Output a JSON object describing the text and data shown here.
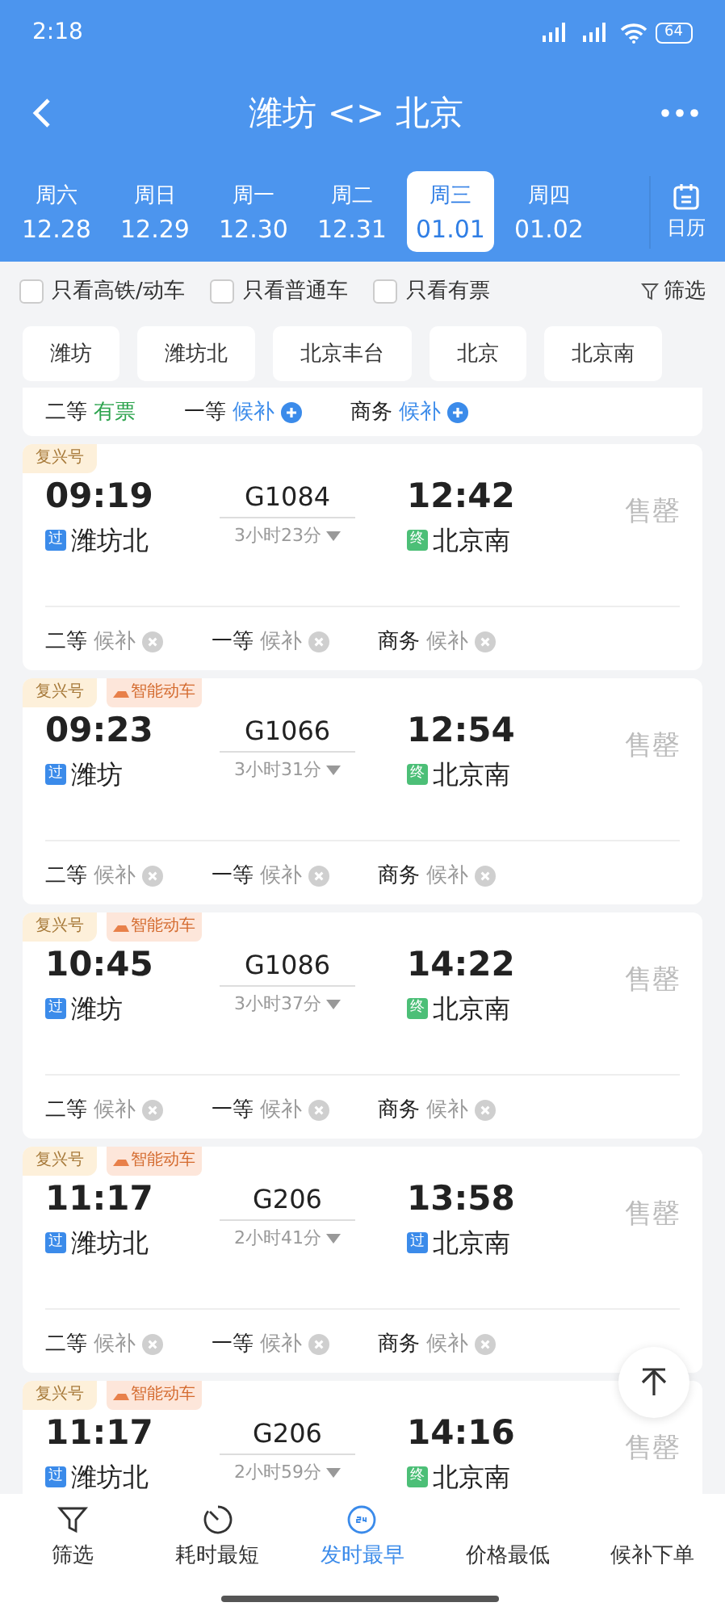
{
  "status_bar": {
    "time": "2:18",
    "battery": "64"
  },
  "header": {
    "title": "潍坊 <> 北京"
  },
  "dates": [
    {
      "weekday": "周六",
      "date": "12.28",
      "selected": false
    },
    {
      "weekday": "周日",
      "date": "12.29",
      "selected": false
    },
    {
      "weekday": "周一",
      "date": "12.30",
      "selected": false
    },
    {
      "weekday": "周二",
      "date": "12.31",
      "selected": false
    },
    {
      "weekday": "周三",
      "date": "01.01",
      "selected": true
    },
    {
      "weekday": "周四",
      "date": "01.02",
      "selected": false
    }
  ],
  "calendar_button": "日历",
  "filters": [
    {
      "label": "只看高铁/动车",
      "checked": false
    },
    {
      "label": "只看普通车",
      "checked": false
    },
    {
      "label": "只看有票",
      "checked": false
    }
  ],
  "filter_button": "筛选",
  "stations": [
    "潍坊",
    "潍坊北",
    "北京丰台",
    "北京",
    "北京南"
  ],
  "partial_card": {
    "seats": [
      {
        "class": "二等",
        "status": "有票",
        "kind": "available"
      },
      {
        "class": "一等",
        "status": "候补",
        "kind": "waitlist_open"
      },
      {
        "class": "商务",
        "status": "候补",
        "kind": "waitlist_open"
      }
    ]
  },
  "trains": [
    {
      "tags": [
        {
          "label": "复兴号",
          "kind": "plain"
        }
      ],
      "depart": "09:19",
      "number": "G1084",
      "arrive": "12:42",
      "duration": "3小时23分",
      "from": {
        "badge": "过",
        "name": "潍坊北",
        "kind": "pass"
      },
      "to": {
        "badge": "终",
        "name": "北京南",
        "kind": "terminal"
      },
      "status": "售罄",
      "seats": [
        {
          "class": "二等",
          "status": "候补",
          "kind": "waitlist_closed"
        },
        {
          "class": "一等",
          "status": "候补",
          "kind": "waitlist_closed"
        },
        {
          "class": "商务",
          "status": "候补",
          "kind": "waitlist_closed"
        }
      ]
    },
    {
      "tags": [
        {
          "label": "复兴号",
          "kind": "plain"
        },
        {
          "label": "智能动车",
          "kind": "smart"
        }
      ],
      "depart": "09:23",
      "number": "G1066",
      "arrive": "12:54",
      "duration": "3小时31分",
      "from": {
        "badge": "过",
        "name": "潍坊",
        "kind": "pass"
      },
      "to": {
        "badge": "终",
        "name": "北京南",
        "kind": "terminal"
      },
      "status": "售罄",
      "seats": [
        {
          "class": "二等",
          "status": "候补",
          "kind": "waitlist_closed"
        },
        {
          "class": "一等",
          "status": "候补",
          "kind": "waitlist_closed"
        },
        {
          "class": "商务",
          "status": "候补",
          "kind": "waitlist_closed"
        }
      ]
    },
    {
      "tags": [
        {
          "label": "复兴号",
          "kind": "plain"
        },
        {
          "label": "智能动车",
          "kind": "smart"
        }
      ],
      "depart": "10:45",
      "number": "G1086",
      "arrive": "14:22",
      "duration": "3小时37分",
      "from": {
        "badge": "过",
        "name": "潍坊",
        "kind": "pass"
      },
      "to": {
        "badge": "终",
        "name": "北京南",
        "kind": "terminal"
      },
      "status": "售罄",
      "seats": [
        {
          "class": "二等",
          "status": "候补",
          "kind": "waitlist_closed"
        },
        {
          "class": "一等",
          "status": "候补",
          "kind": "waitlist_closed"
        },
        {
          "class": "商务",
          "status": "候补",
          "kind": "waitlist_closed"
        }
      ]
    },
    {
      "tags": [
        {
          "label": "复兴号",
          "kind": "plain"
        },
        {
          "label": "智能动车",
          "kind": "smart"
        }
      ],
      "depart": "11:17",
      "number": "G206",
      "arrive": "13:58",
      "duration": "2小时41分",
      "from": {
        "badge": "过",
        "name": "潍坊北",
        "kind": "pass"
      },
      "to": {
        "badge": "过",
        "name": "北京南",
        "kind": "pass"
      },
      "status": "售罄",
      "seats": [
        {
          "class": "二等",
          "status": "候补",
          "kind": "waitlist_closed"
        },
        {
          "class": "一等",
          "status": "候补",
          "kind": "waitlist_closed"
        },
        {
          "class": "商务",
          "status": "候补",
          "kind": "waitlist_closed"
        }
      ]
    },
    {
      "tags": [
        {
          "label": "复兴号",
          "kind": "plain"
        },
        {
          "label": "智能动车",
          "kind": "smart"
        }
      ],
      "depart": "11:17",
      "number": "G206",
      "arrive": "14:16",
      "duration": "2小时59分",
      "from": {
        "badge": "过",
        "name": "潍坊北",
        "kind": "pass"
      },
      "to": {
        "badge": "终",
        "name": "北京南",
        "kind": "terminal"
      },
      "status": "售罄"
    }
  ],
  "bottom_nav": [
    {
      "label": "筛选",
      "selected": false
    },
    {
      "label": "耗时最短",
      "selected": false
    },
    {
      "label": "发时最早",
      "selected": true
    },
    {
      "label": "价格最低",
      "selected": false
    },
    {
      "label": "候补下单",
      "selected": false
    }
  ]
}
